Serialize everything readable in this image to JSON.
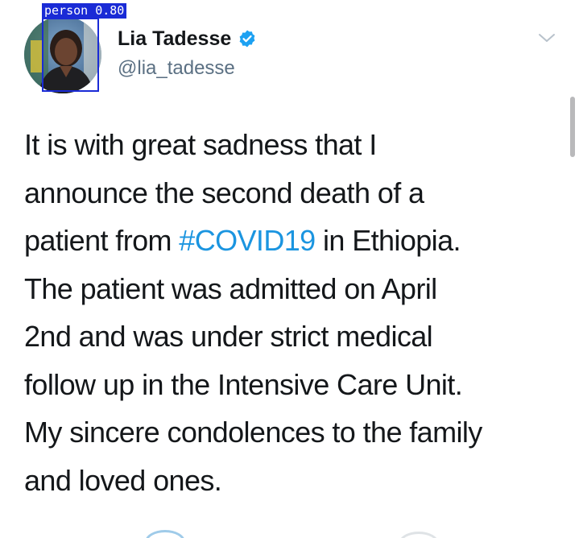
{
  "detection": {
    "label": "person 0.80"
  },
  "user": {
    "display_name": "Lia Tadesse",
    "handle": "@lia_tadesse",
    "verified": true,
    "avatar_icon": "profile-photo"
  },
  "tweet": {
    "lines": [
      {
        "text": "It is with great sadness that I"
      },
      {
        "text": "announce the second death of a"
      },
      {
        "before": "patient from ",
        "hashtag": "#COVID19",
        "after": " in Ethiopia."
      },
      {
        "text": "The patient was admitted on April"
      },
      {
        "text": "2nd and was under strict medical"
      },
      {
        "text": "follow up in the Intensive Care Unit."
      },
      {
        "text": "My sincere condolences to the family"
      },
      {
        "text": "and loved ones."
      }
    ]
  },
  "colors": {
    "hashtag": "#1b95e0",
    "verified_badge": "#1da1f2",
    "detection_box": "#1a2bd6",
    "handle": "#5b7083"
  },
  "icons": {
    "menu": "chevron-down-icon",
    "verified": "verified-badge-icon"
  }
}
